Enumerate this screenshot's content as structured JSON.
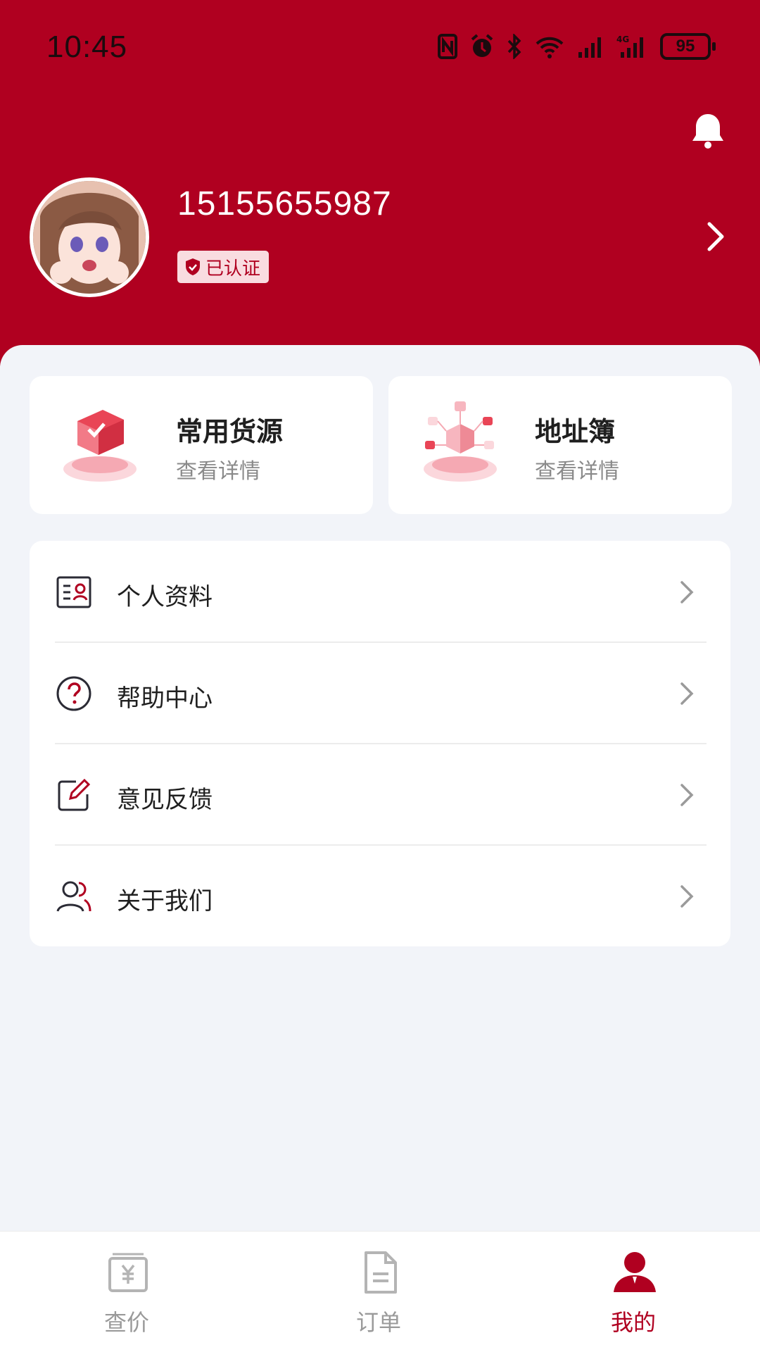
{
  "colors": {
    "brand": "#b00020",
    "background": "#f2f4f9",
    "card": "#ffffff",
    "text_primary": "#1f1f1f",
    "text_secondary": "#8a8a8a",
    "verified_bg": "#f9dce0"
  },
  "status_bar": {
    "time": "10:45",
    "battery": "95",
    "icons": [
      "nfc-icon",
      "alarm-icon",
      "bluetooth-icon",
      "wifi-icon",
      "signal-icon",
      "4g-signal-icon",
      "battery-icon"
    ]
  },
  "profile": {
    "phone": "15155655987",
    "verified_label": "已认证"
  },
  "quick_cards": [
    {
      "title": "常用货源",
      "subtitle": "查看详情",
      "icon": "package-illustration"
    },
    {
      "title": "地址簿",
      "subtitle": "查看详情",
      "icon": "network-illustration"
    }
  ],
  "menu": [
    {
      "label": "个人资料",
      "icon": "profile-card-icon"
    },
    {
      "label": "帮助中心",
      "icon": "help-circle-icon"
    },
    {
      "label": "意见反馈",
      "icon": "edit-feedback-icon"
    },
    {
      "label": "关于我们",
      "icon": "users-icon"
    }
  ],
  "tabs": [
    {
      "label": "查价",
      "icon": "price-icon",
      "active": false
    },
    {
      "label": "订单",
      "icon": "order-icon",
      "active": false
    },
    {
      "label": "我的",
      "icon": "person-icon",
      "active": true
    }
  ]
}
